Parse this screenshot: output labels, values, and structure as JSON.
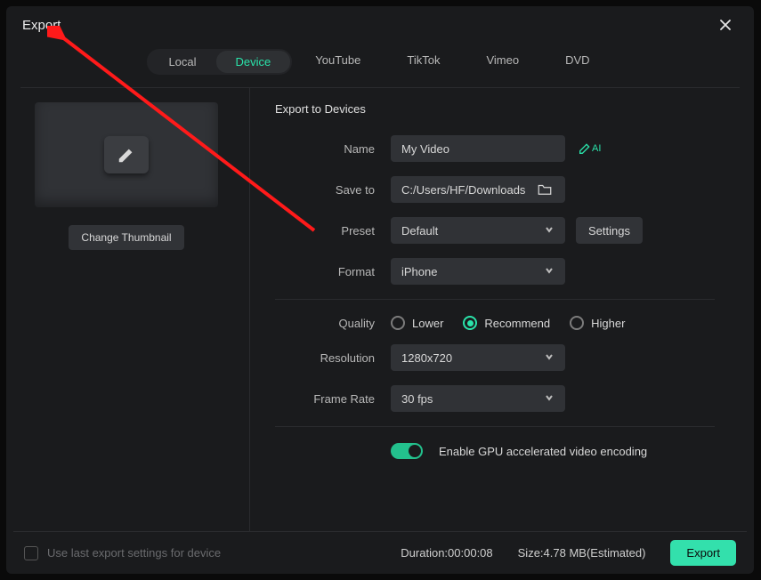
{
  "window_title": "Export",
  "tabs": {
    "local": "Local",
    "device": "Device",
    "youtube": "YouTube",
    "tiktok": "TikTok",
    "vimeo": "Vimeo",
    "dvd": "DVD"
  },
  "section_title": "Export to Devices",
  "fields": {
    "name_label": "Name",
    "name_value": "My Video",
    "save_label": "Save to",
    "save_value": "C:/Users/HF/Downloads",
    "preset_label": "Preset",
    "preset_value": "Default",
    "settings_label": "Settings",
    "format_label": "Format",
    "format_value": "iPhone",
    "quality_label": "Quality",
    "quality_lower": "Lower",
    "quality_recommend": "Recommend",
    "quality_higher": "Higher",
    "resolution_label": "Resolution",
    "resolution_value": "1280x720",
    "framerate_label": "Frame Rate",
    "framerate_value": "30 fps",
    "gpu_label": "Enable GPU accelerated video encoding"
  },
  "change_thumb_label": "Change Thumbnail",
  "footer": {
    "uselast_label": "Use last export settings for device",
    "duration_label": "Duration:",
    "duration_value": "00:00:08",
    "size_label": "Size:",
    "size_value": "4.78 MB(Estimated)",
    "export_label": "Export"
  },
  "ai_suffix": "AI"
}
